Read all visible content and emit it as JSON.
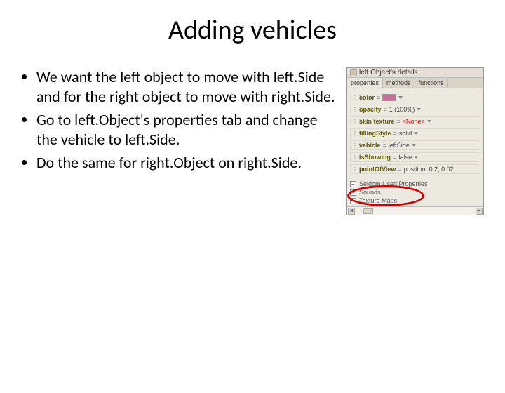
{
  "title": "Adding vehicles",
  "bullets": [
    "We want the left object to move with left.Side and for the right object to move with right.Side.",
    "Go to left.Object's properties tab and change the vehicle to left.Side.",
    "Do the same for right.Object on right.Side."
  ],
  "panel": {
    "header": "left.Object's details",
    "tabs": [
      "properties",
      "methods",
      "functions"
    ],
    "activeTab": 0,
    "props": {
      "color": {
        "label": "color"
      },
      "opacity": {
        "label": "opacity",
        "value": "1 (100%)"
      },
      "skin": {
        "label": "skin texture",
        "value": "<None>"
      },
      "filling": {
        "label": "fillingStyle",
        "value": "solid"
      },
      "vehicle": {
        "label": "vehicle",
        "value": "leftSide"
      },
      "isShowing": {
        "label": "isShowing",
        "value": "false"
      },
      "pointOfView": {
        "label": "pointOfView",
        "value": "position: 0.2, 0.02,"
      }
    },
    "expandable": [
      "Seldom Used Properties",
      "Sounds",
      "Texture Maps"
    ]
  }
}
